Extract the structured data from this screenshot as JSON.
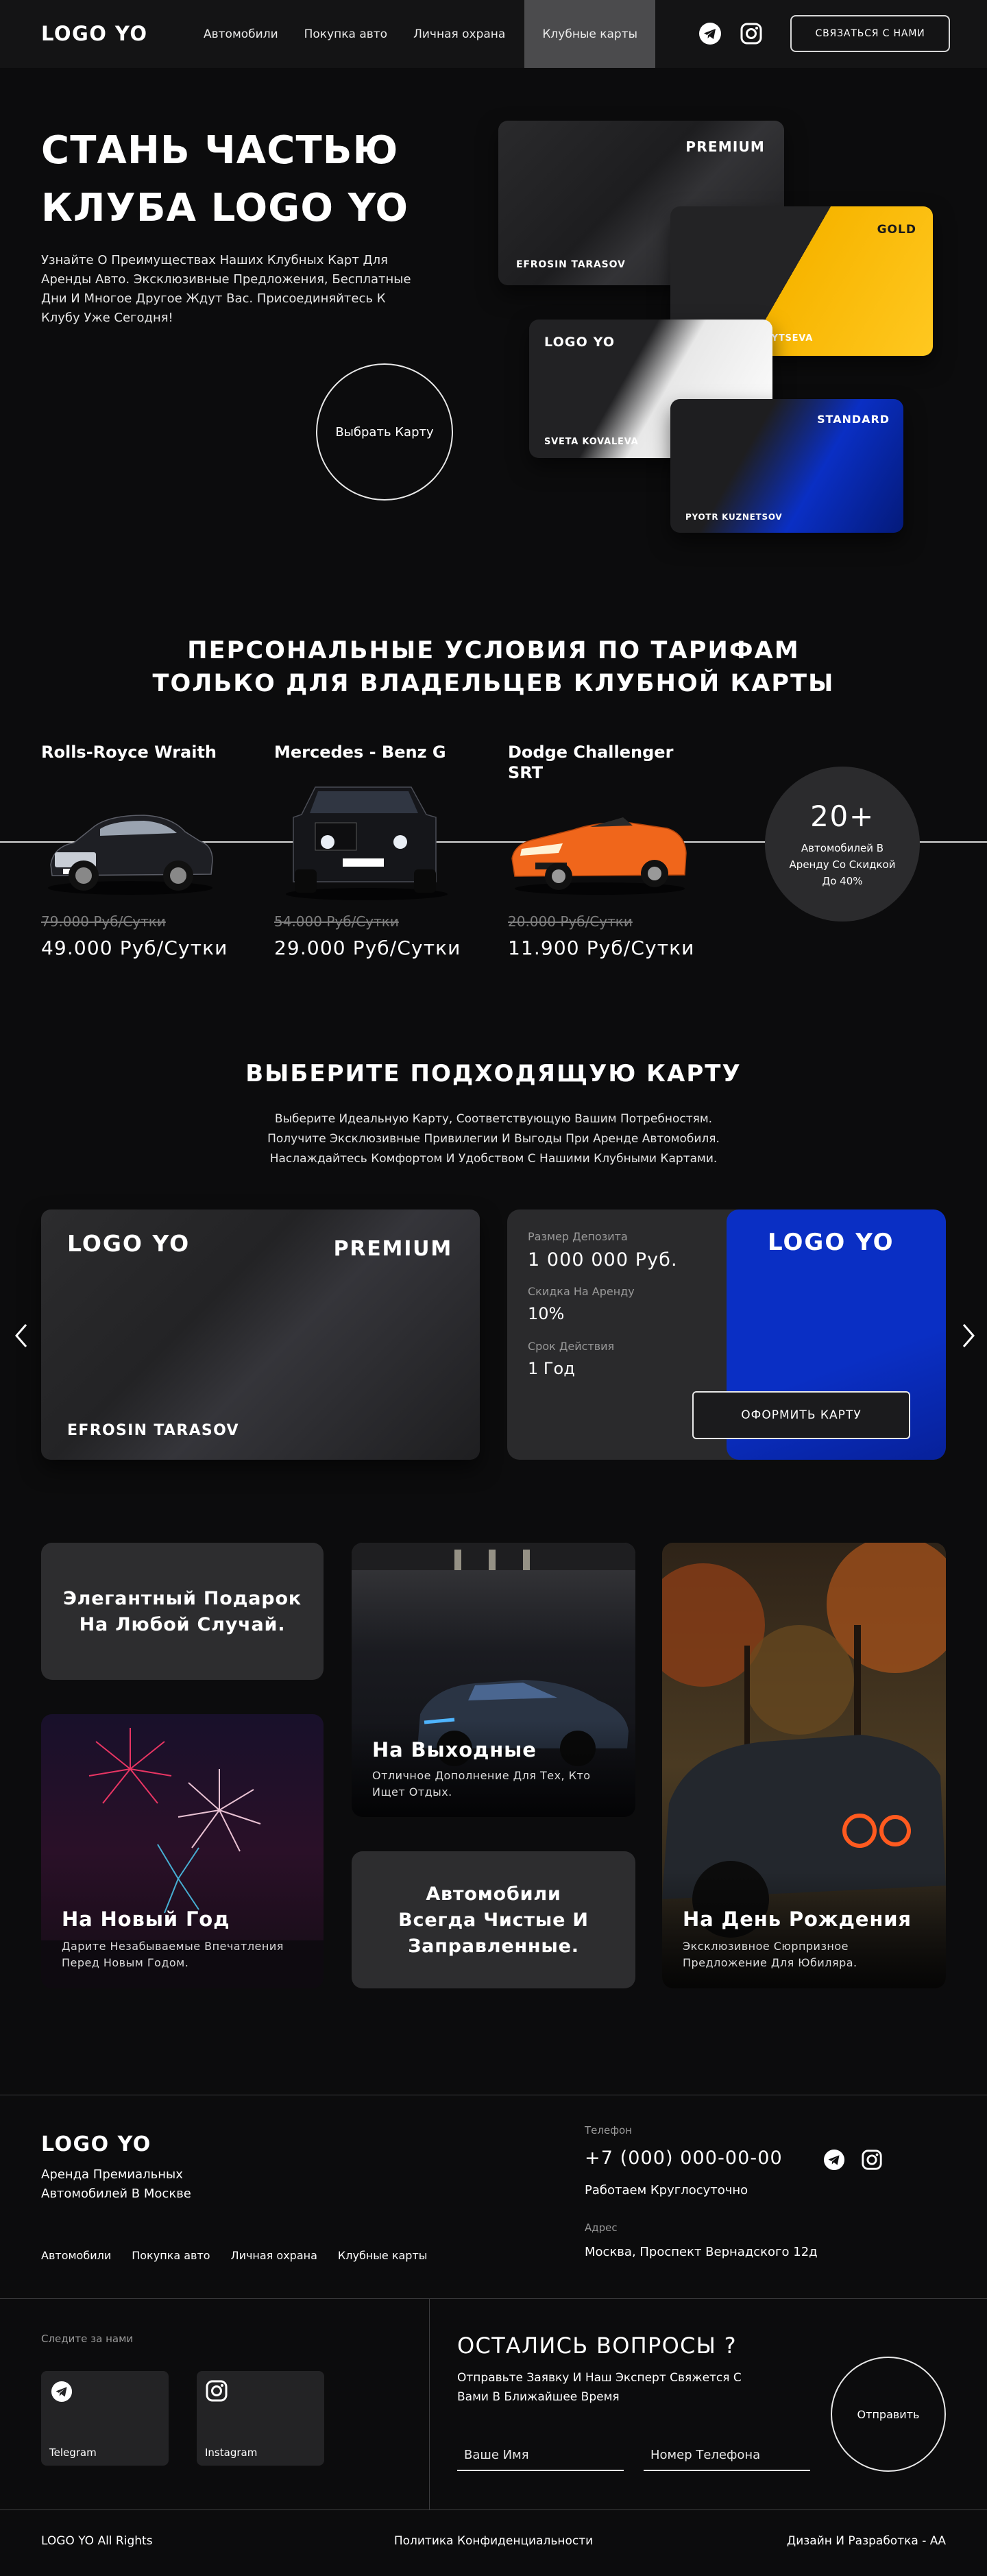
{
  "header": {
    "logo": "LOGO YO",
    "nav": [
      "Автомобили",
      "Покупка авто",
      "Личная охрана",
      "Клубные карты"
    ],
    "contact_label": "СВЯЗАТЬСЯ С НАМИ"
  },
  "hero": {
    "title_line1": "СТАНЬ ЧАСТЬЮ",
    "title_line2": "КЛУБА LOGO YO",
    "text": "Узнайте О Преимуществах Наших Клубных Карт Для Аренды Авто. Эксклюзивные Предложения, Бесплатные Дни И Многое Другое Ждут Вас. Присоединяйтесь К Клубу Уже Сегодня!",
    "cta": "Выбрать Карту",
    "cards": [
      {
        "tier": "PREMIUM",
        "holder": "EFROSIN TARASOV"
      },
      {
        "tier": "GOLD",
        "holder": "ANASTASIYA ZAYTSEVA"
      },
      {
        "tier": "LOGO YO",
        "holder": "SVETA KOVALEVA"
      },
      {
        "tier": "STANDARD",
        "holder": "PYOTR KUZNETSOV"
      }
    ]
  },
  "tariffs": {
    "title_line1": "ПЕРСОНАЛЬНЫЕ УСЛОВИЯ ПО ТАРИФАМ",
    "title_line2": "ТОЛЬКО ДЛЯ ВЛАДЕЛЬЦЕВ КЛУБНОЙ КАРТЫ",
    "cars": [
      {
        "name": "Rolls-Royce Wraith",
        "old": "79.000 Руб/Сутки",
        "new": "49.000 Руб/Сутки"
      },
      {
        "name": "Mercedes - Benz G",
        "old": "54.000 Руб/Сутки",
        "new": "29.000 Руб/Сутки"
      },
      {
        "name": "Dodge Challenger SRT",
        "old": "20.000 Руб/Сутки",
        "new": "11.900 Руб/Сутки"
      }
    ],
    "badge_number": "20+",
    "badge_text": "Автомобилей В Аренду Со Скидкой До 40%"
  },
  "choose": {
    "title": "ВЫБЕРИТЕ ПОДХОДЯЩУЮ КАРТУ",
    "text_line1": "Выберите Идеальную Карту, Соответствующую Вашим Потребностям.",
    "text_line2": "Получите Эксклюзивные Привилегии И Выгоды При Аренде Автомобиля.",
    "text_line3": "Наслаждайтесь Комфортом И Удобством С Нашими Клубными Картами.",
    "card_logo": "LOGO YO",
    "card_tier": "PREMIUM",
    "card_holder": "EFROSIN TARASOV",
    "deposit_label": "Размер Депозита",
    "deposit_value": "1 000 000 Руб.",
    "discount_label": "Скидка На Аренду",
    "discount_value": "10%",
    "term_label": "Срок Действия",
    "term_value": "1 Год",
    "blue_logo": "LOGO YO",
    "order_button": "ОФОРМИТЬ КАРТУ"
  },
  "gallery": {
    "gift": "Элегантный Подарок На Любой Случай.",
    "weekend_title": "На Выходные",
    "weekend_text": "Отличное Дополнение Для Тех, Кто Ищет Отдых.",
    "newyear_title": "На Новый Год",
    "newyear_text": "Дарите Незабываемые Впечатления Перед Новым Годом.",
    "clean": "Автомобили Всегда Чистые И Заправленные.",
    "birthday_title": "На День Рождения",
    "birthday_text": "Эксклюзивное Сюрпризное Предложение Для Юбиляра."
  },
  "footer": {
    "logo": "LOGO YO",
    "tagline": "Аренда Премиальных Автомобилей В Москве",
    "nav": [
      "Автомобили",
      "Покупка авто",
      "Личная охрана",
      "Клубные карты"
    ],
    "phone_label": "Телефон",
    "phone": "+7 (000) 000-00-00",
    "hours": "Работаем Круглосуточно",
    "address_label": "Адрес",
    "address": "Москва, Проспект Вернадского 12д",
    "follow": "Следите за нами",
    "telegram": "Telegram",
    "instagram": "Instagram",
    "questions_title": "ОСТАЛИСЬ ВОПРОСЫ ?",
    "questions_text": "Отправьте Заявку И Наш Эксперт Свяжется С Вами В Ближайшее Время",
    "name_placeholder": "Ваше Имя",
    "phone_placeholder": "Номер Телефона",
    "send": "Отправить",
    "rights": "LOGO YO All Rights",
    "privacy": "Политика Конфиденциальности",
    "design": "Дизайн И Разработка - АА"
  },
  "colors": {
    "bg": "#0c0c0d",
    "gold": "#f7b500",
    "blue": "#0a2fc4",
    "header": "#141415"
  }
}
